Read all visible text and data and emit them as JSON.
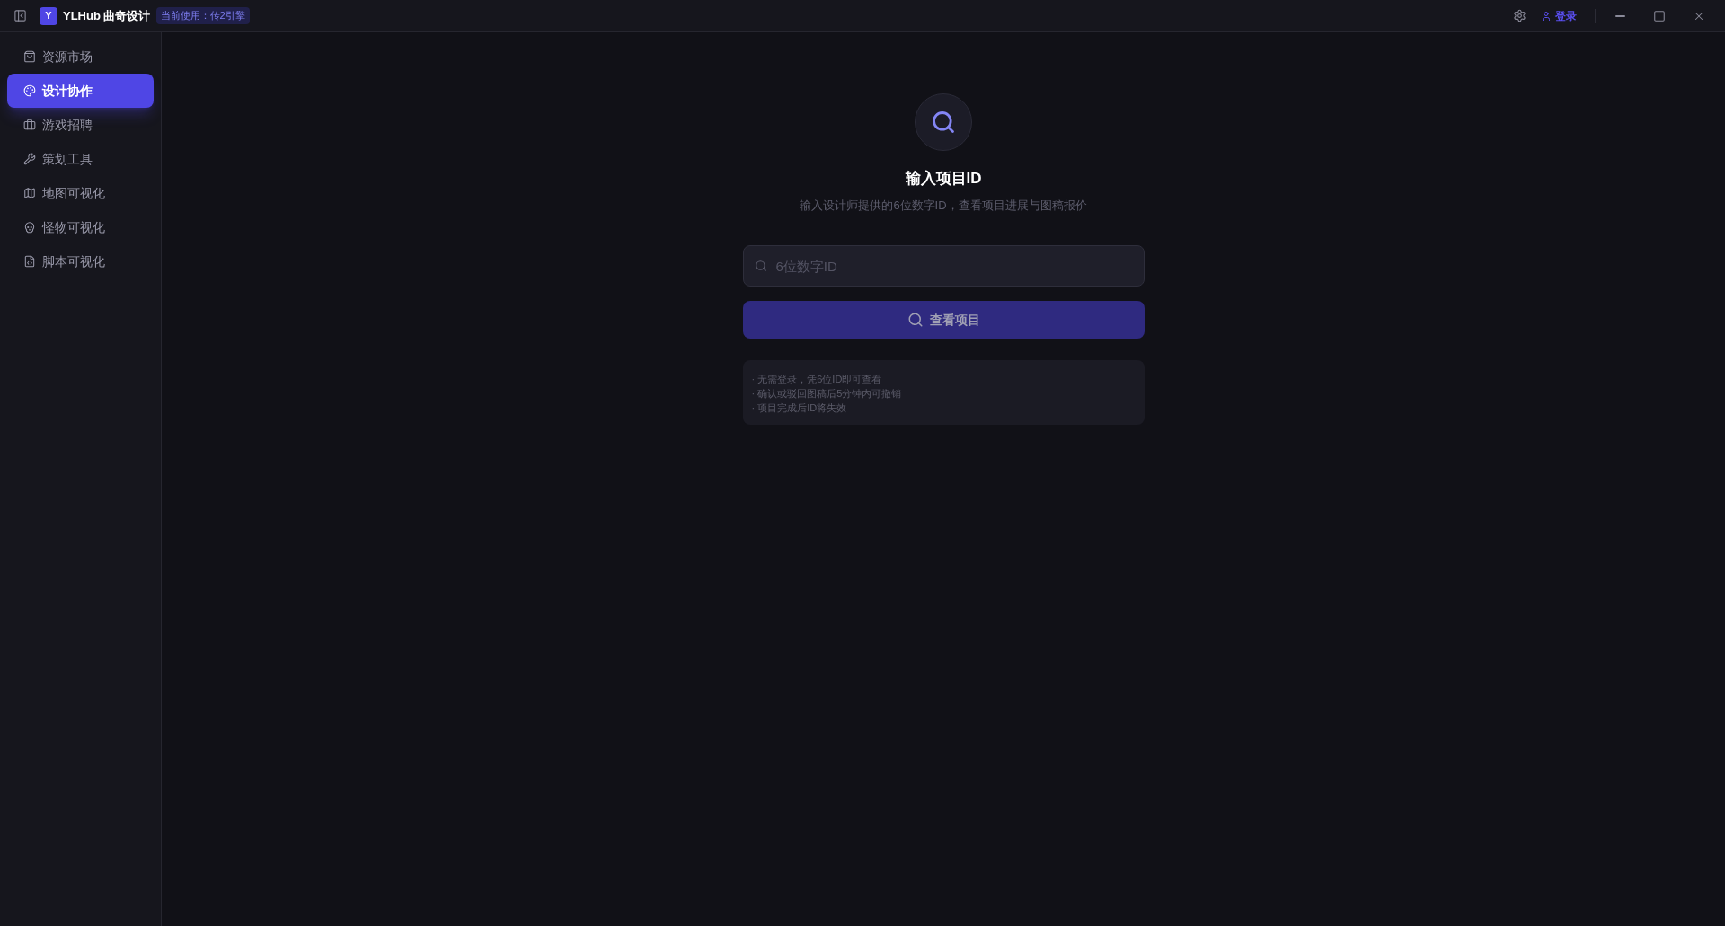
{
  "title_bar": {
    "logo_letter": "Y",
    "app_name": "YLHub 曲奇设计",
    "engine_badge": "当前使用：传2引擎",
    "login_link": "登录"
  },
  "sidebar": {
    "items": [
      {
        "label": "资源市场",
        "selected": false
      },
      {
        "label": "设计协作",
        "selected": true
      },
      {
        "label": "游戏招聘",
        "selected": false
      },
      {
        "label": "策划工具",
        "selected": false
      },
      {
        "label": "地图可视化",
        "selected": false
      },
      {
        "label": "怪物可视化",
        "selected": false
      },
      {
        "label": "脚本可视化",
        "selected": false
      }
    ]
  },
  "main": {
    "title": "输入项目ID",
    "subtitle": "输入设计师提供的6位数字ID，查看项目进展与图稿报价",
    "search_field": {
      "placeholder": "6位数字ID"
    },
    "view_button": {
      "label": "查看项目"
    },
    "notes": [
      "· 无需登录，凭6位ID即可查看",
      "· 确认或驳回图稿后5分钟内可撤销",
      "· 项目完成后ID将失效"
    ]
  }
}
